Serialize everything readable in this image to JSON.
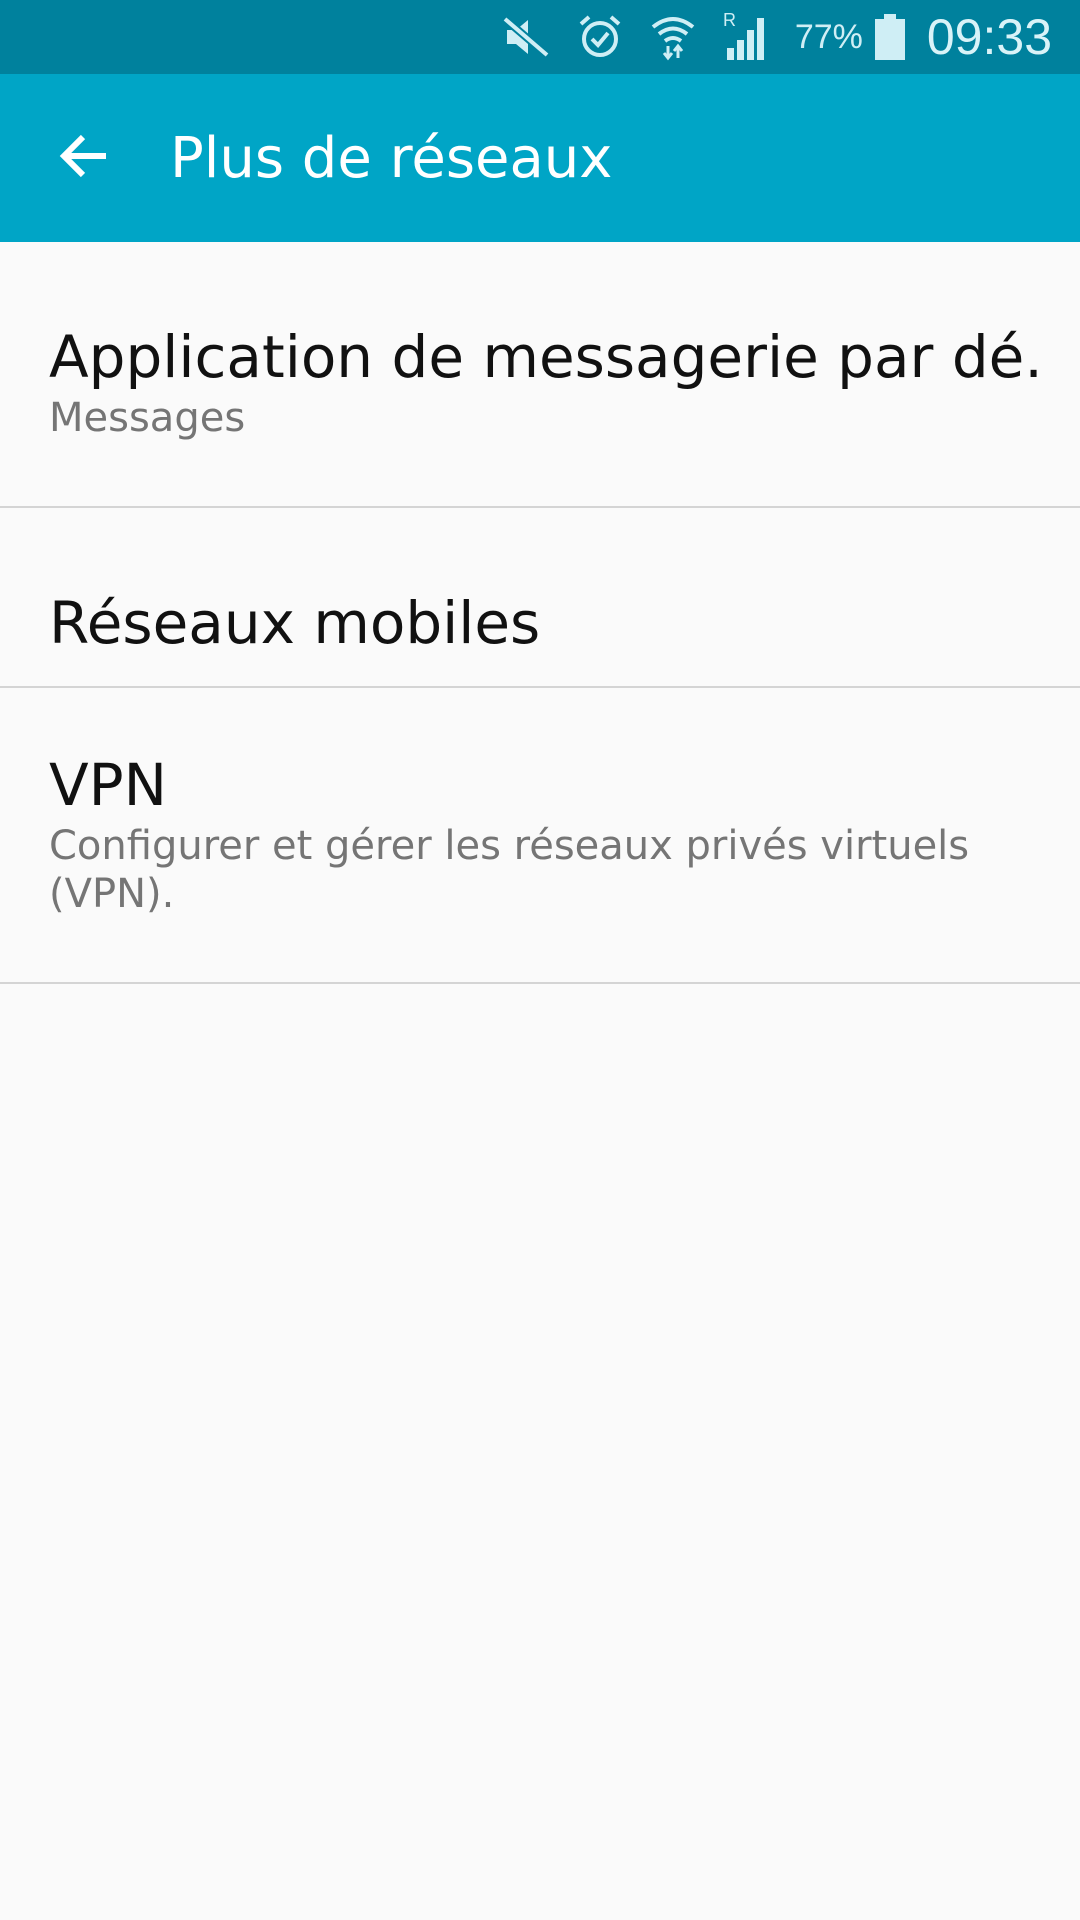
{
  "status_bar": {
    "battery_percent": "77%",
    "time": "09:33",
    "roaming_indicator": "R",
    "icons": [
      "mute-icon",
      "alarm-icon",
      "wifi-icon",
      "signal-icon",
      "battery-icon"
    ]
  },
  "app_bar": {
    "title": "Plus de réseaux",
    "back_icon": "arrow-left-icon"
  },
  "settings": [
    {
      "title": "Application de messagerie par dé..",
      "subtitle": "Messages"
    },
    {
      "title": "Réseaux mobiles"
    },
    {
      "title": "VPN",
      "subtitle": "Configurer et gérer les réseaux privés virtuels (VPN)."
    }
  ],
  "colors": {
    "status_bar": "#00819d",
    "app_bar": "#00a5c6",
    "background": "#fafafa",
    "divider": "#d4d4d4",
    "title_text": "#111111",
    "subtitle_text": "#757575"
  }
}
